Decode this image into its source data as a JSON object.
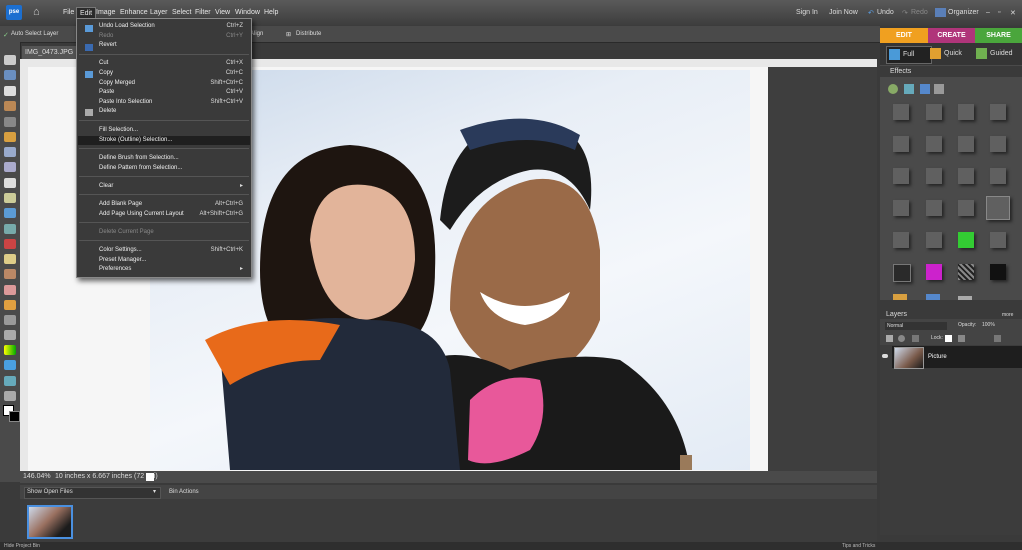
{
  "menubar": {
    "logo": "pse",
    "items": [
      "File",
      "Edit",
      "Image",
      "Enhance",
      "Layer",
      "Select",
      "Filter",
      "View",
      "Window",
      "Help"
    ],
    "active": "Edit",
    "right": {
      "sign_in": "Sign In",
      "join_now": "Join Now",
      "undo": "Undo",
      "redo": "Redo",
      "organizer": "Organizer"
    }
  },
  "options": {
    "auto_select": "Auto Select Layer",
    "align": "Align",
    "distribute": "Distribute"
  },
  "modes": {
    "edit": "EDIT",
    "create": "CREATE",
    "share": "SHARE",
    "full": "Full",
    "quick": "Quick",
    "guided": "Guided"
  },
  "document": {
    "tab_title": "IMG_0473.JPG @ 1",
    "zoom": "146.04%",
    "info": "10 inches x 6.667 inches (72 ppi)"
  },
  "edit_menu": [
    {
      "label": "Undo Load Selection",
      "shortcut": "Ctrl+Z",
      "enabled": true
    },
    {
      "label": "Redo",
      "shortcut": "Ctrl+Y",
      "enabled": false
    },
    {
      "label": "Revert",
      "shortcut": "",
      "enabled": true
    },
    {
      "label": "Cut",
      "shortcut": "Ctrl+X",
      "enabled": true
    },
    {
      "label": "Copy",
      "shortcut": "Ctrl+C",
      "enabled": true
    },
    {
      "label": "Copy Merged",
      "shortcut": "Shift+Ctrl+C",
      "enabled": true
    },
    {
      "label": "Paste",
      "shortcut": "Ctrl+V",
      "enabled": true
    },
    {
      "label": "Paste Into Selection",
      "shortcut": "Shift+Ctrl+V",
      "enabled": true
    },
    {
      "label": "Delete",
      "shortcut": "",
      "enabled": true
    },
    {
      "label": "Fill Selection...",
      "shortcut": "",
      "enabled": true
    },
    {
      "label": "Stroke (Outline) Selection...",
      "shortcut": "",
      "enabled": true,
      "highlighted": true
    },
    {
      "label": "Define Brush from Selection...",
      "shortcut": "",
      "enabled": true
    },
    {
      "label": "Define Pattern from Selection...",
      "shortcut": "",
      "enabled": true
    },
    {
      "label": "Clear",
      "shortcut": "",
      "enabled": true,
      "submenu": true
    },
    {
      "label": "Add Blank Page",
      "shortcut": "Alt+Ctrl+G",
      "enabled": true
    },
    {
      "label": "Add Page Using Current Layout",
      "shortcut": "Alt+Shift+Ctrl+G",
      "enabled": true
    },
    {
      "label": "Delete Current Page",
      "shortcut": "",
      "enabled": false
    },
    {
      "label": "Color Settings...",
      "shortcut": "Shift+Ctrl+K",
      "enabled": true
    },
    {
      "label": "Preset Manager...",
      "shortcut": "",
      "enabled": true
    },
    {
      "label": "Preferences",
      "shortcut": "",
      "enabled": true,
      "submenu": true
    }
  ],
  "effects": {
    "title": "Effects"
  },
  "layers": {
    "title": "Layers",
    "mode": "Normal",
    "opacity_label": "Opacity:",
    "opacity": "100%",
    "lock": "Lock:",
    "more": "more",
    "layer_name": "Picture"
  },
  "bin": {
    "show": "Show Open Files",
    "actions": "Bin Actions"
  },
  "footer": {
    "hide": "Hide Project Bin",
    "tips": "Tips and Tricks"
  }
}
